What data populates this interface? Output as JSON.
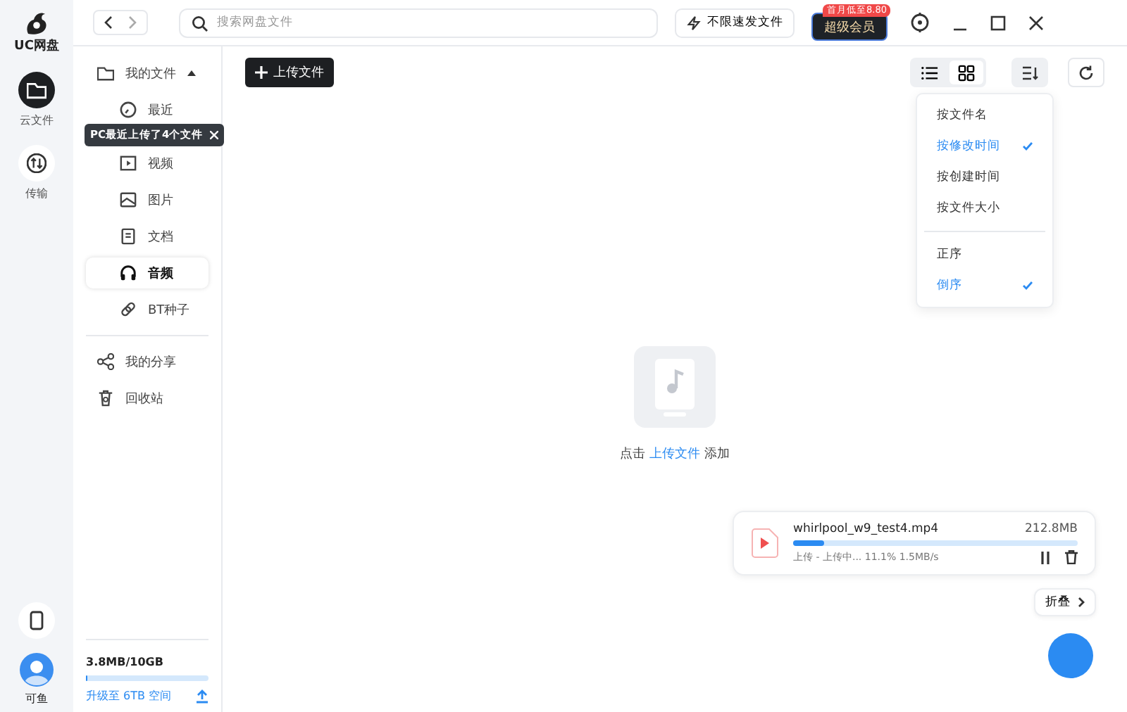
{
  "app": {
    "logo": "UC网盘"
  },
  "rail": [
    {
      "label": "云文件",
      "selected": true
    },
    {
      "label": "传输",
      "selected": false
    }
  ],
  "user": {
    "name": "可鱼"
  },
  "topbar": {
    "search": {
      "placeholder": "搜索网盘文件"
    },
    "send_button": "不限速发文件",
    "vip_button": "超级会员",
    "vip_badge": "首月低至8.80"
  },
  "sidebar": {
    "items": [
      {
        "label": "我的文件",
        "expanded": true,
        "selected": false,
        "children": [
          {
            "label": "最近",
            "selected": false
          },
          {
            "label": "视频",
            "selected": false
          },
          {
            "label": "图片",
            "selected": false
          },
          {
            "label": "文档",
            "selected": false
          },
          {
            "label": "音频",
            "selected": true
          },
          {
            "label": "BT种子",
            "selected": false
          }
        ]
      },
      {
        "label": "我的分享",
        "selected": false
      },
      {
        "label": "回收站",
        "selected": false
      }
    ],
    "tooltip": "PC最近上传了4个文件",
    "storage": {
      "usage": "3.8MB/10GB",
      "level": 0.01,
      "upgrade": "升级至 6TB 空间"
    }
  },
  "toolbar": {
    "upload_button": "上传文件",
    "views": [
      {
        "selected": false
      },
      {
        "selected": true
      }
    ]
  },
  "sort_menu": {
    "fields": [
      {
        "label": "按文件名",
        "selected": false
      },
      {
        "label": "按修改时间",
        "selected": true
      },
      {
        "label": "按创建时间",
        "selected": false
      },
      {
        "label": "按文件大小",
        "selected": false
      }
    ],
    "orders": [
      {
        "label": "正序",
        "selected": false
      },
      {
        "label": "倒序",
        "selected": true
      }
    ]
  },
  "empty_state": {
    "before": "点击",
    "link": "上传文件",
    "after": "添加"
  },
  "upload_card": {
    "filename": "whirlpool_w9_test4.mp4",
    "size": "212.8MB",
    "status": "上传 - 上传中... 11.1% 1.5MB/s",
    "level": 0.111
  },
  "collapse_button": "折叠"
}
